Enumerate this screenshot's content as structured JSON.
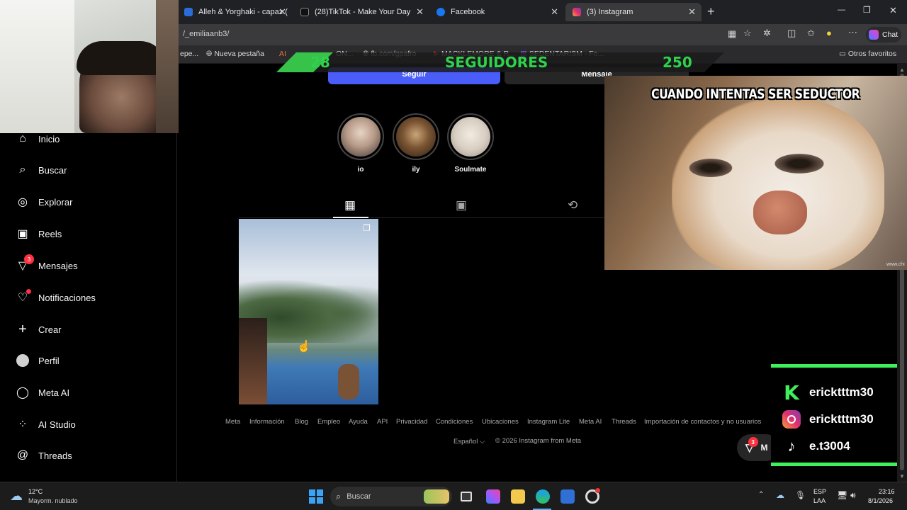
{
  "browser": {
    "tabs": [
      {
        "title": "Alleh & Yorghaki - capaz (mer",
        "favicon_color": "#2b6cd9",
        "close": "✕"
      },
      {
        "title": "(28)TikTok - Make Your Day",
        "favicon_color": "#111111",
        "close": "✕"
      },
      {
        "title": "Facebook",
        "favicon_color": "#1877f2",
        "close": "✕"
      },
      {
        "title": "(3) Instagram",
        "favicon_color": "#e1306c",
        "close": "✕",
        "active": true
      }
    ],
    "new_tab": "+",
    "window_controls": {
      "minimize": "—",
      "restore": "❐",
      "close": "✕"
    },
    "url": "/_emiliaanb3/",
    "chat_label": "Chat",
    "bookmarks": [
      {
        "label": "epe..."
      },
      {
        "label": "Nueva pestaña"
      },
      {
        "label": "AI"
      },
      {
        "label": "ON..."
      },
      {
        "label": "fb.com/gpafro"
      },
      {
        "label": "MACKLEMORE & R..."
      },
      {
        "label": "SEDENTARISM - Fo..."
      }
    ],
    "other_favorites": "Otros favoritos"
  },
  "stream_overlay": {
    "followers_current": "28",
    "followers_label": "SEGUIDORES",
    "followers_goal": "250",
    "meme_caption": "CUANDO INTENTAS SER SEDUCTOR",
    "meme_watermark": "www.chi",
    "socials": [
      {
        "icon": "kick-icon",
        "handle": "ericktttm30"
      },
      {
        "icon": "instagram-icon",
        "handle": "ericktttm30"
      },
      {
        "icon": "tiktok-icon",
        "handle": "e.t3004"
      }
    ]
  },
  "instagram": {
    "sidebar": [
      {
        "label": "Inicio",
        "icon": "home-icon"
      },
      {
        "label": "Buscar",
        "icon": "search-icon"
      },
      {
        "label": "Explorar",
        "icon": "compass-icon"
      },
      {
        "label": "Reels",
        "icon": "reels-icon"
      },
      {
        "label": "Mensajes",
        "icon": "messenger-icon",
        "badge": "3"
      },
      {
        "label": "Notificaciones",
        "icon": "heart-icon"
      },
      {
        "label": "Crear",
        "icon": "plus-icon"
      },
      {
        "label": "Perfil",
        "icon": "avatar-icon"
      },
      {
        "label": "Meta AI",
        "icon": "meta-ai-icon"
      },
      {
        "label": "AI Studio",
        "icon": "ai-studio-icon"
      },
      {
        "label": "Threads",
        "icon": "threads-icon"
      }
    ],
    "profile": {
      "follow_button": "Seguir",
      "message_button": "Mensaje"
    },
    "highlights": [
      {
        "label": "io"
      },
      {
        "label": "ily"
      },
      {
        "label": "Soulmate"
      }
    ],
    "tabs": [
      {
        "icon": "grid-icon",
        "active": true
      },
      {
        "icon": "reels-tab-icon"
      },
      {
        "icon": "repost-icon"
      }
    ],
    "footer_links": [
      "Meta",
      "Información",
      "Blog",
      "Empleo",
      "Ayuda",
      "API",
      "Privacidad",
      "Condiciones",
      "Ubicaciones",
      "Instagram Lite",
      "Meta AI",
      "Threads",
      "Importación de contactos y no usuarios"
    ],
    "language": "Español",
    "copyright": "© 2026 Instagram from Meta",
    "messages_fab_badge": "3",
    "messages_fab_label": "M"
  },
  "taskbar": {
    "weather_temp": "12°C",
    "weather_desc": "Mayorm. nublado",
    "search_placeholder": "Buscar",
    "lang_top": "ESP",
    "lang_bottom": "LAA",
    "time": "23:16",
    "date": "8/1/2026"
  }
}
